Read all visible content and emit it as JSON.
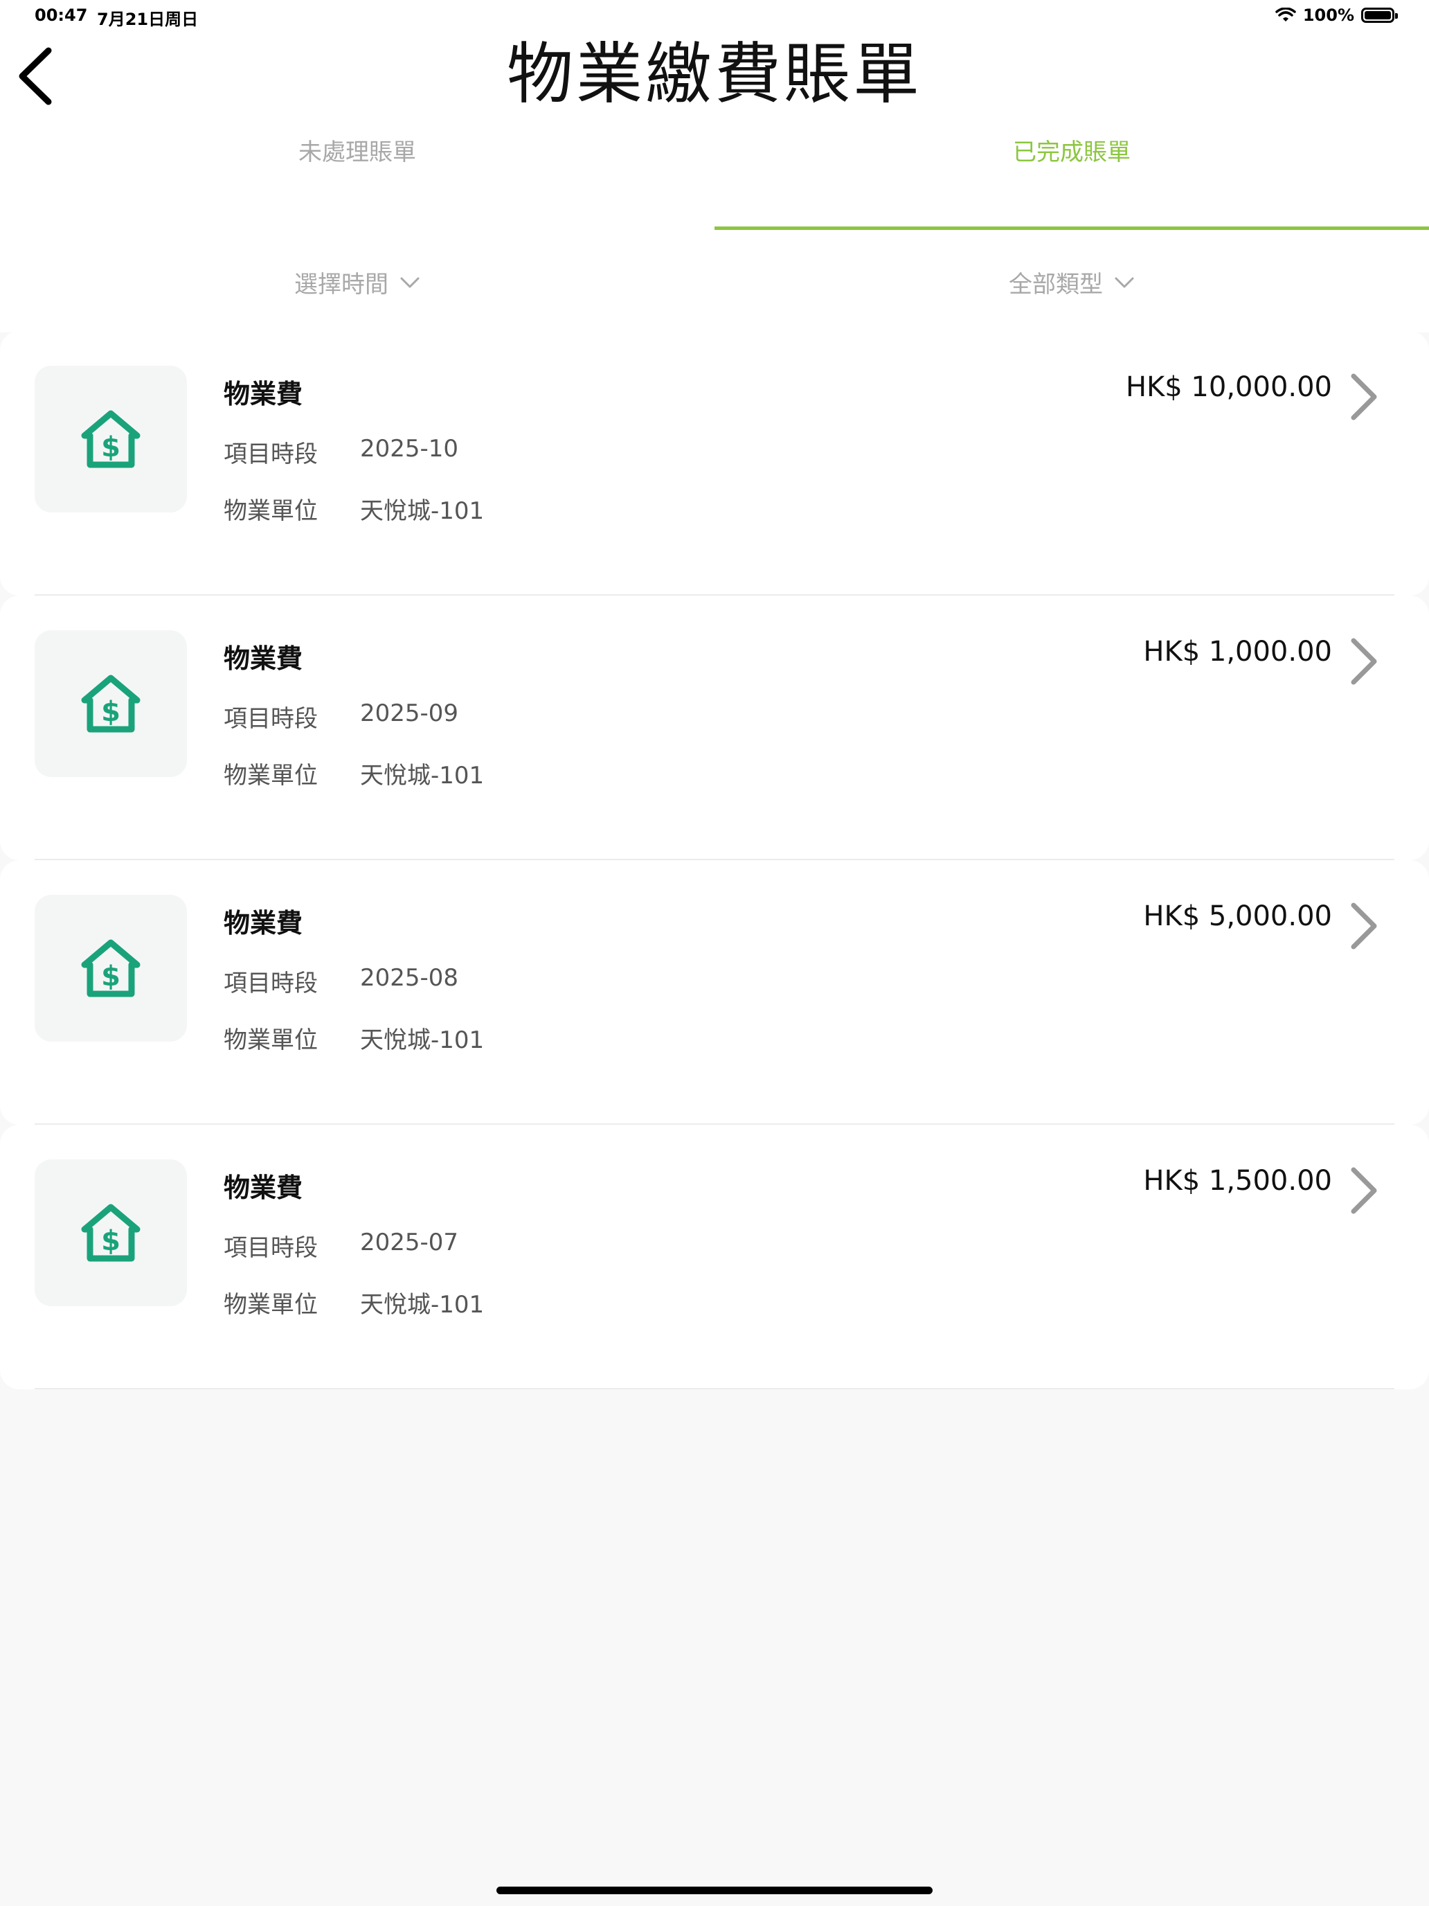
{
  "status_bar": {
    "time": "00:47",
    "date": "7月21日周日",
    "battery": "100%"
  },
  "header": {
    "title": "物業繳費賬單"
  },
  "tabs": [
    {
      "label": "未處理賬單",
      "active": false
    },
    {
      "label": "已完成賬單",
      "active": true
    }
  ],
  "filters": {
    "time": "選擇時間",
    "type": "全部類型"
  },
  "labels": {
    "period": "項目時段",
    "unit": "物業單位"
  },
  "bills": [
    {
      "title": "物業費",
      "amount": "HK$ 10,000.00",
      "period": "2025-10",
      "unit": "天悅城-101"
    },
    {
      "title": "物業費",
      "amount": "HK$ 1,000.00",
      "period": "2025-09",
      "unit": "天悅城-101"
    },
    {
      "title": "物業費",
      "amount": "HK$ 5,000.00",
      "period": "2025-08",
      "unit": "天悅城-101"
    },
    {
      "title": "物業費",
      "amount": "HK$ 1,500.00",
      "period": "2025-07",
      "unit": "天悅城-101"
    }
  ],
  "colors": {
    "accent": "#8cc63f",
    "icon": "#1aa37a",
    "muted": "#a8a8a8"
  },
  "icons": {
    "back": "chevron-left-icon",
    "dropdown": "chevron-down-icon",
    "bill": "house-dollar-icon",
    "row_arrow": "chevron-right-icon",
    "wifi": "wifi-icon",
    "battery": "battery-icon"
  }
}
